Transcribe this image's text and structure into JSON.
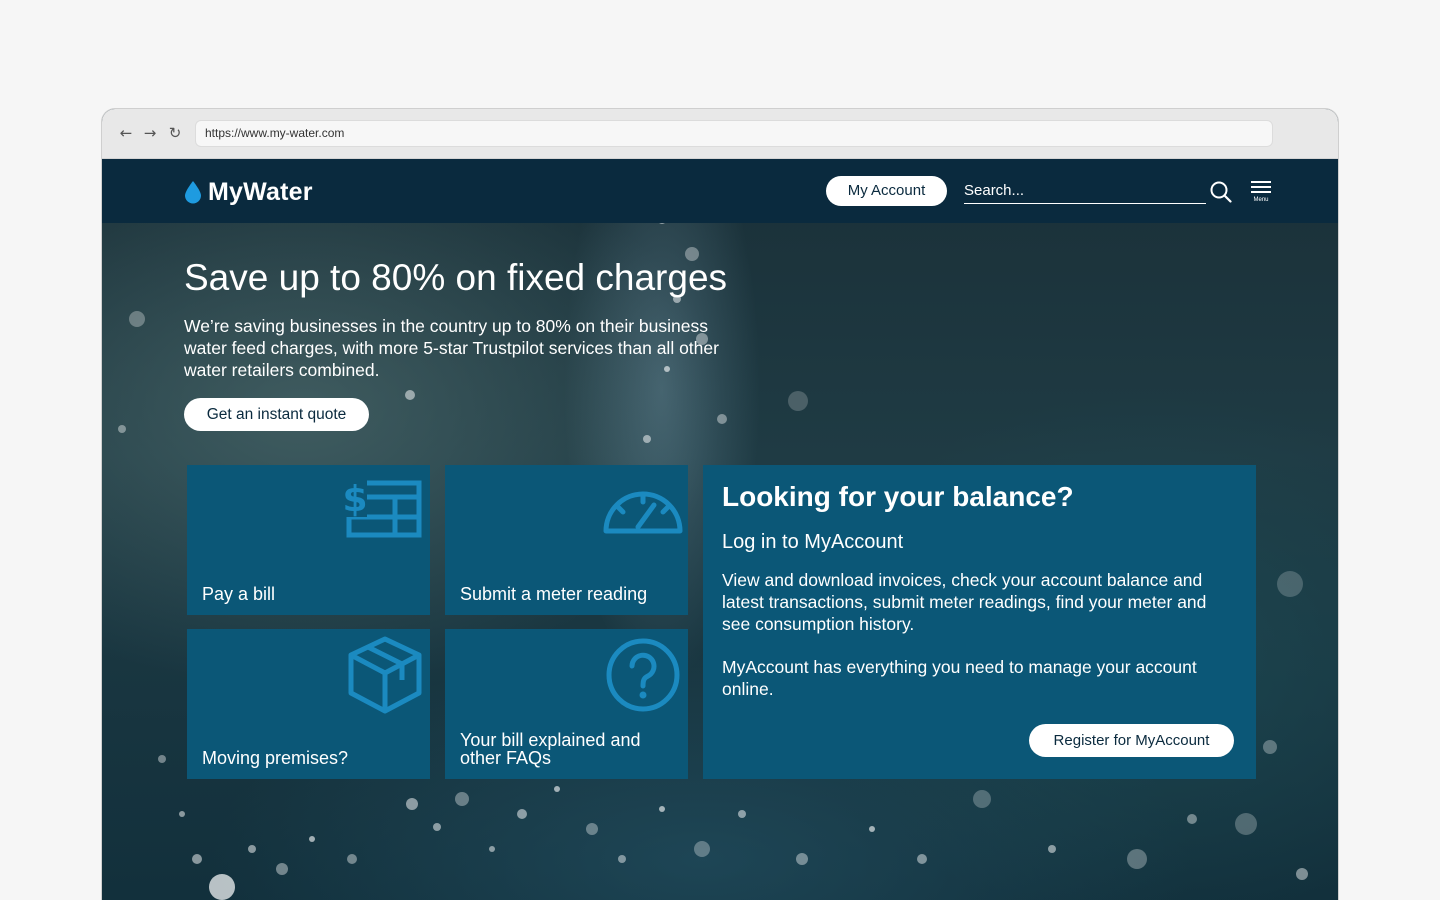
{
  "browser": {
    "url": "https://www.my-water.com"
  },
  "header": {
    "logo_text": "MyWater",
    "my_account_label": "My Account",
    "search_placeholder": "Search...",
    "menu_label": "Menu"
  },
  "hero": {
    "title": "Save up to 80% on fixed charges",
    "text": "We’re saving businesses in the country up to 80% on their business water feed charges, with more 5-star Trustpilot services than all other water retailers combined.",
    "cta_label": "Get an instant quote"
  },
  "tiles": [
    {
      "label": "Pay a bill",
      "icon": "bill-icon"
    },
    {
      "label": "Submit a meter reading",
      "icon": "meter-gauge-icon"
    },
    {
      "label": "Moving premises?",
      "icon": "box-icon"
    },
    {
      "label": "Your bill explained and other FAQs",
      "icon": "question-circle-icon"
    }
  ],
  "balance": {
    "title": "Looking for your balance?",
    "subtitle": "Log in to MyAccount",
    "paragraph1": "View and download invoices, check your account balance and latest transactions, submit meter readings, find your meter and see consumption history.",
    "paragraph2": "MyAccount has everything you need to manage your account online.",
    "register_label": "Register for MyAccount"
  },
  "colors": {
    "header_bg": "#0a2a3e",
    "tile_bg": "#0b5777",
    "icon_color": "#1b8ac0",
    "logo_drop": "#1e9be0"
  }
}
